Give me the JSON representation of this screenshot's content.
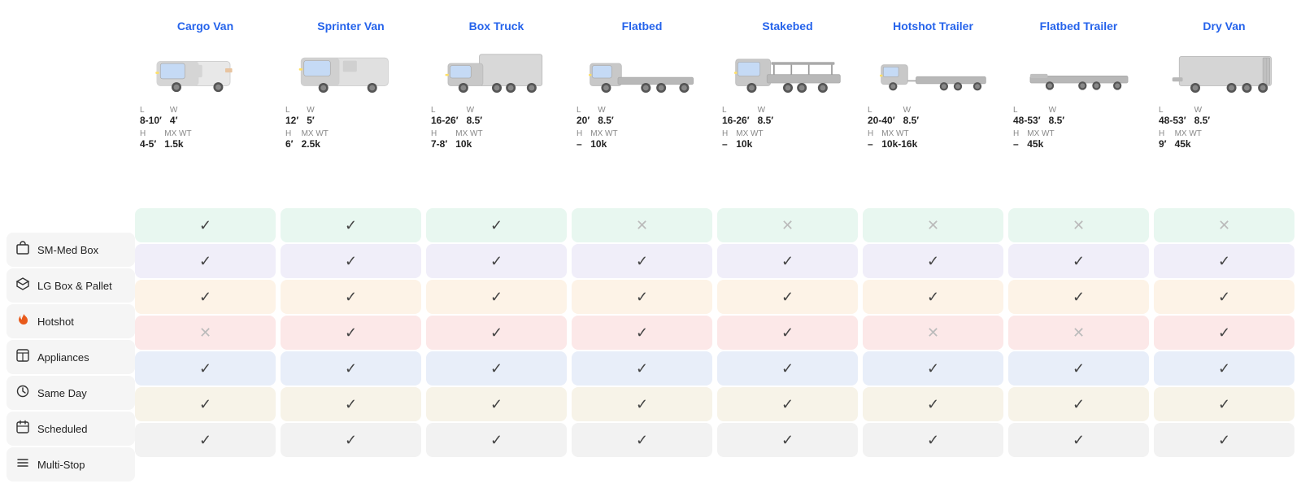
{
  "sidebar": {
    "items": [
      {
        "id": "sm-med-box",
        "label": "SM-Med Box",
        "icon": "📦"
      },
      {
        "id": "lg-box-pallet",
        "label": "LG Box & Pallet",
        "icon": "◇"
      },
      {
        "id": "hotshot",
        "label": "Hotshot",
        "icon": "🔥"
      },
      {
        "id": "appliances",
        "label": "Appliances",
        "icon": "📅"
      },
      {
        "id": "same-day",
        "label": "Same Day",
        "icon": "⏱"
      },
      {
        "id": "scheduled",
        "label": "Scheduled",
        "icon": "📅"
      },
      {
        "id": "multi-stop",
        "label": "Multi-Stop",
        "icon": "☰"
      }
    ]
  },
  "vehicles": [
    {
      "id": "cargo-van",
      "name": "Cargo Van",
      "specs": {
        "L": "8-10′",
        "W": "4′",
        "H": "4-5′",
        "MX_WT": "1.5k"
      },
      "capabilities": [
        true,
        true,
        true,
        false,
        true,
        true,
        true
      ]
    },
    {
      "id": "sprinter-van",
      "name": "Sprinter Van",
      "specs": {
        "L": "12′",
        "W": "5′",
        "H": "6′",
        "MX_WT": "2.5k"
      },
      "capabilities": [
        true,
        true,
        true,
        true,
        true,
        true,
        true
      ]
    },
    {
      "id": "box-truck",
      "name": "Box Truck",
      "specs": {
        "L": "16-26′",
        "W": "8.5′",
        "H": "7-8′",
        "MX_WT": "10k"
      },
      "capabilities": [
        true,
        true,
        true,
        true,
        true,
        true,
        true
      ]
    },
    {
      "id": "flatbed",
      "name": "Flatbed",
      "specs": {
        "L": "20′",
        "W": "8.5′",
        "H": "–",
        "MX_WT": "10k"
      },
      "capabilities": [
        false,
        true,
        true,
        true,
        true,
        true,
        true
      ]
    },
    {
      "id": "stakebed",
      "name": "Stakebed",
      "specs": {
        "L": "16-26′",
        "W": "8.5′",
        "H": "–",
        "MX_WT": "10k"
      },
      "capabilities": [
        false,
        true,
        true,
        true,
        true,
        true,
        true
      ]
    },
    {
      "id": "hotshot-trailer",
      "name": "Hotshot Trailer",
      "specs": {
        "L": "20-40′",
        "W": "8.5′",
        "H": "–",
        "MX_WT": "10k-16k"
      },
      "capabilities": [
        false,
        true,
        true,
        false,
        true,
        true,
        true
      ]
    },
    {
      "id": "flatbed-trailer",
      "name": "Flatbed Trailer",
      "specs": {
        "L": "48-53′",
        "W": "8.5′",
        "H": "–",
        "MX_WT": "45k"
      },
      "capabilities": [
        false,
        true,
        true,
        false,
        true,
        true,
        true
      ]
    },
    {
      "id": "dry-van",
      "name": "Dry Van",
      "specs": {
        "L": "48-53′",
        "W": "8.5′",
        "H": "9′",
        "MX_WT": "45k"
      },
      "capabilities": [
        false,
        true,
        true,
        true,
        true,
        true,
        true
      ]
    }
  ],
  "row_colors": [
    "row-green",
    "row-lavender",
    "row-peach",
    "row-pink",
    "row-blue",
    "row-tan",
    "row-gray"
  ]
}
